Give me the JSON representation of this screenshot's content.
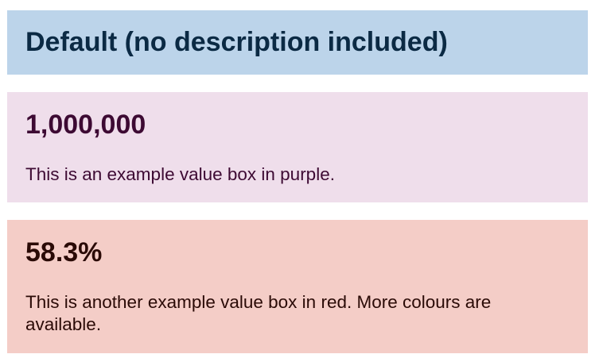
{
  "boxes": {
    "default": {
      "title": "Default (no description included)",
      "colors": {
        "background": "#bcd4ea",
        "text": "#0b2a44"
      }
    },
    "purple": {
      "value": "1,000,000",
      "description": "This is an example value box in purple.",
      "colors": {
        "background": "#efdeeb",
        "text": "#3d0a33"
      }
    },
    "red": {
      "value": "58.3%",
      "description": "This is another example value box in red. More colours are available.",
      "colors": {
        "background": "#f4cdc7",
        "text": "#2a0a06"
      }
    }
  }
}
